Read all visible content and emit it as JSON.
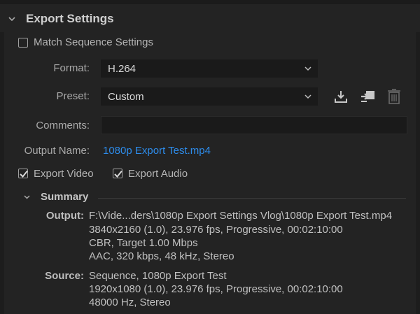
{
  "section": {
    "title": "Export Settings"
  },
  "match_sequence": {
    "label": "Match Sequence Settings",
    "checked": false
  },
  "format": {
    "label": "Format:",
    "value": "H.264"
  },
  "preset": {
    "label": "Preset:",
    "value": "Custom"
  },
  "preset_icons": [
    "save-preset-icon",
    "import-preset-icon",
    "delete-preset-icon"
  ],
  "comments": {
    "label": "Comments:",
    "value": ""
  },
  "output_name": {
    "label": "Output Name:",
    "value": "1080p Export Test.mp4"
  },
  "export_video": {
    "label": "Export Video",
    "checked": true
  },
  "export_audio": {
    "label": "Export Audio",
    "checked": true
  },
  "summary": {
    "title": "Summary",
    "output": {
      "label": "Output:",
      "lines": [
        "F:\\Vide...ders\\1080p Export Settings Vlog\\1080p Export Test.mp4",
        "3840x2160 (1.0), 23.976 fps, Progressive, 00:02:10:00",
        "CBR, Target 1.00 Mbps",
        "AAC, 320 kbps, 48 kHz, Stereo"
      ]
    },
    "source": {
      "label": "Source:",
      "lines": [
        "Sequence, 1080p Export Test",
        "1920x1080 (1.0), 23.976 fps, Progressive, 00:02:10:00",
        "48000 Hz, Stereo"
      ]
    }
  },
  "colors": {
    "link": "#2d8ceb",
    "background": "#232323",
    "field": "#1a1a1a"
  }
}
